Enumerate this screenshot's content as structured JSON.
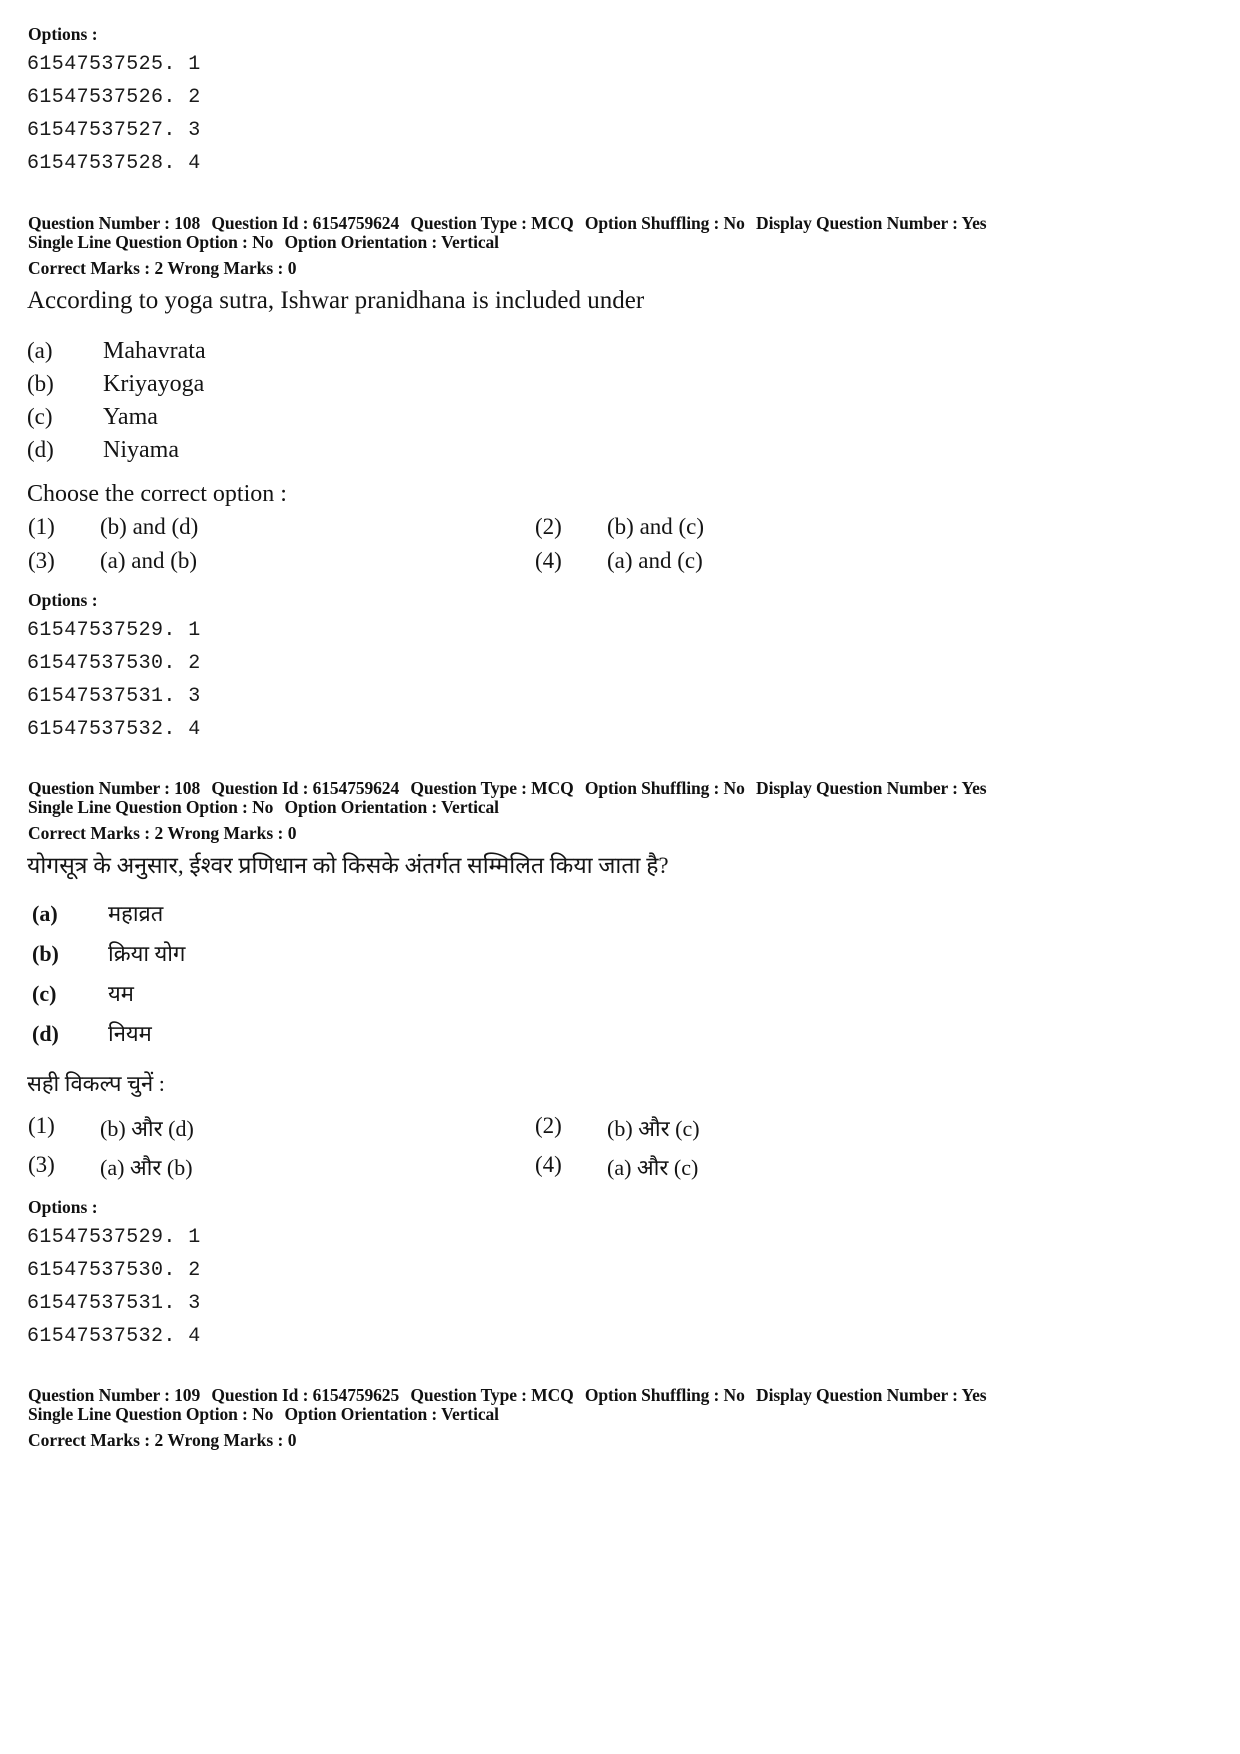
{
  "blocks": {
    "top_options": {
      "heading": "Options :",
      "ids": [
        "61547537525. 1",
        "61547537526. 2",
        "61547537527. 3",
        "61547537528. 4"
      ]
    },
    "q108_en": {
      "meta_line1": {
        "question_number_label": "Question Number :",
        "question_number": "108",
        "question_id_label": "Question Id :",
        "question_id": "6154759624",
        "question_type_label": "Question Type :",
        "question_type": "MCQ",
        "option_shuffling_label": "Option Shuffling :",
        "option_shuffling": "No",
        "display_question_number_label": "Display Question Number :",
        "display_question_number": "Yes"
      },
      "meta_line2": {
        "single_line_label": "Single Line Question Option :",
        "single_line": "No",
        "orientation_label": "Option Orientation :",
        "orientation": "Vertical"
      },
      "marks": {
        "correct_label": "Correct Marks :",
        "correct": "2",
        "wrong_label": "Wrong Marks :",
        "wrong": "0"
      },
      "question": "According to yoga sutra, Ishwar pranidhana is included under",
      "statements": [
        {
          "label": "(a)",
          "text": "Mahavrata"
        },
        {
          "label": "(b)",
          "text": "Kriyayoga"
        },
        {
          "label": "(c)",
          "text": "Yama"
        },
        {
          "label": "(d)",
          "text": "Niyama"
        }
      ],
      "choose_label": "Choose the correct option :",
      "choices": [
        {
          "num": "(1)",
          "text": "(b) and (d)"
        },
        {
          "num": "(2)",
          "text": "(b) and (c)"
        },
        {
          "num": "(3)",
          "text": "(a) and (b)"
        },
        {
          "num": "(4)",
          "text": "(a) and (c)"
        }
      ],
      "options": {
        "heading": "Options :",
        "ids": [
          "61547537529. 1",
          "61547537530. 2",
          "61547537531. 3",
          "61547537532. 4"
        ]
      }
    },
    "q108_hi": {
      "meta_line1": {
        "question_number_label": "Question Number :",
        "question_number": "108",
        "question_id_label": "Question Id :",
        "question_id": "6154759624",
        "question_type_label": "Question Type :",
        "question_type": "MCQ",
        "option_shuffling_label": "Option Shuffling :",
        "option_shuffling": "No",
        "display_question_number_label": "Display Question Number :",
        "display_question_number": "Yes"
      },
      "meta_line2": {
        "single_line_label": "Single Line Question Option :",
        "single_line": "No",
        "orientation_label": "Option Orientation :",
        "orientation": "Vertical"
      },
      "marks": {
        "correct_label": "Correct Marks :",
        "correct": "2",
        "wrong_label": "Wrong Marks :",
        "wrong": "0"
      },
      "question": "योगसूत्र के अनुसार, ईश्वर प्रणिधान को किसके अंतर्गत सम्मिलित किया जाता है?",
      "statements": [
        {
          "label": "(a)",
          "text": "महाव्रत"
        },
        {
          "label": "(b)",
          "text": "क्रिया योग"
        },
        {
          "label": "(c)",
          "text": "यम"
        },
        {
          "label": "(d)",
          "text": "नियम"
        }
      ],
      "choose_label": "सही विकल्प चुनें :",
      "choices": [
        {
          "num": "(1)",
          "text": "(b) और (d)"
        },
        {
          "num": "(2)",
          "text": "(b) और (c)"
        },
        {
          "num": "(3)",
          "text": "(a) और (b)"
        },
        {
          "num": "(4)",
          "text": "(a) और (c)"
        }
      ],
      "options": {
        "heading": "Options :",
        "ids": [
          "61547537529. 1",
          "61547537530. 2",
          "61547537531. 3",
          "61547537532. 4"
        ]
      }
    },
    "q109": {
      "meta_line1": {
        "question_number_label": "Question Number :",
        "question_number": "109",
        "question_id_label": "Question Id :",
        "question_id": "6154759625",
        "question_type_label": "Question Type :",
        "question_type": "MCQ",
        "option_shuffling_label": "Option Shuffling :",
        "option_shuffling": "No",
        "display_question_number_label": "Display Question Number :",
        "display_question_number": "Yes"
      },
      "meta_line2": {
        "single_line_label": "Single Line Question Option :",
        "single_line": "No",
        "orientation_label": "Option Orientation :",
        "orientation": "Vertical"
      },
      "marks": {
        "correct_label": "Correct Marks :",
        "correct": "2",
        "wrong_label": "Wrong Marks :",
        "wrong": "0"
      }
    }
  }
}
